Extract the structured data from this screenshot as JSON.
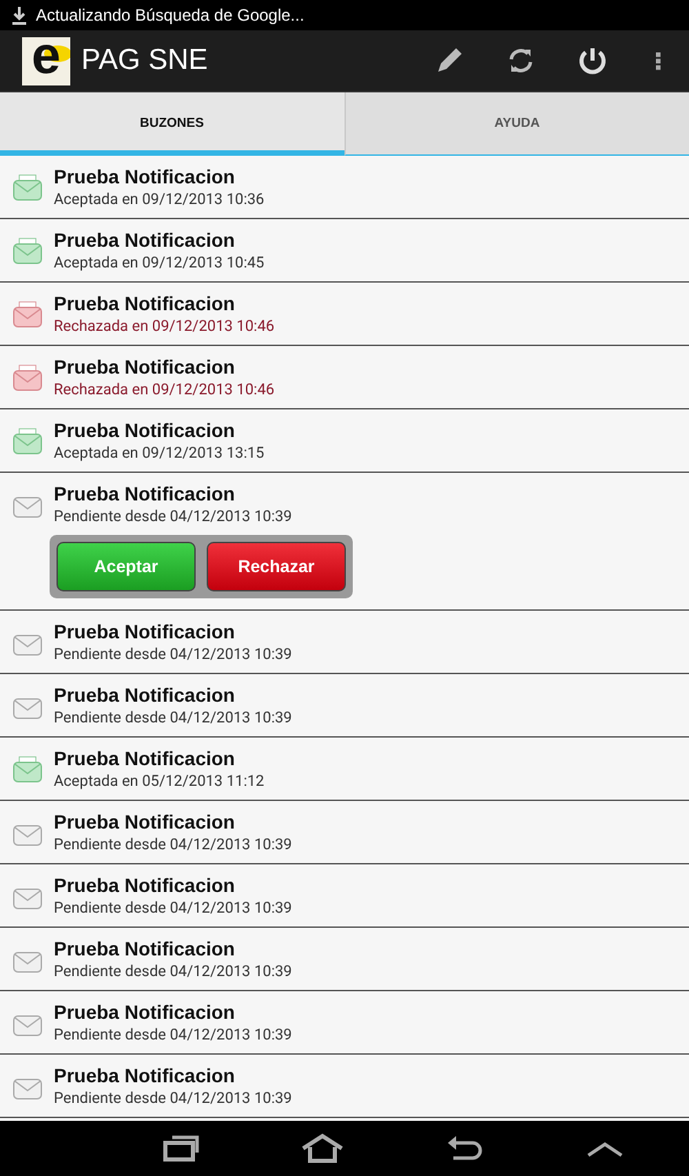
{
  "status_bar": {
    "notification": "Actualizando Búsqueda de Google..."
  },
  "action_bar": {
    "logo_letter": "e",
    "title": "PAG SNE"
  },
  "tabs": [
    {
      "label": "BUZONES",
      "selected": true
    },
    {
      "label": "AYUDA",
      "selected": false
    }
  ],
  "notifications": [
    {
      "title": "Prueba Notificacion",
      "kind": "accepted",
      "subtitle": "Aceptada en 09/12/2013 10:36"
    },
    {
      "title": "Prueba Notificacion",
      "kind": "accepted",
      "subtitle": "Aceptada en 09/12/2013 10:45"
    },
    {
      "title": "Prueba Notificacion",
      "kind": "rejected",
      "subtitle": "Rechazada en 09/12/2013 10:46"
    },
    {
      "title": "Prueba Notificacion",
      "kind": "rejected",
      "subtitle": "Rechazada en 09/12/2013 10:46"
    },
    {
      "title": "Prueba Notificacion",
      "kind": "accepted",
      "subtitle": "Aceptada en 09/12/2013 13:15"
    },
    {
      "title": "Prueba Notificacion",
      "kind": "pending",
      "subtitle": "Pendiente desde 04/12/2013 10:39",
      "actions": [
        "Aceptar",
        "Rechazar"
      ]
    },
    {
      "title": "Prueba Notificacion",
      "kind": "pending",
      "subtitle": "Pendiente desde 04/12/2013 10:39"
    },
    {
      "title": "Prueba Notificacion",
      "kind": "pending",
      "subtitle": "Pendiente desde 04/12/2013 10:39"
    },
    {
      "title": "Prueba Notificacion",
      "kind": "accepted",
      "subtitle": "Aceptada en 05/12/2013 11:12"
    },
    {
      "title": "Prueba Notificacion",
      "kind": "pending",
      "subtitle": "Pendiente desde 04/12/2013 10:39"
    },
    {
      "title": "Prueba Notificacion",
      "kind": "pending",
      "subtitle": "Pendiente desde 04/12/2013 10:39"
    },
    {
      "title": "Prueba Notificacion",
      "kind": "pending",
      "subtitle": "Pendiente desde 04/12/2013 10:39"
    },
    {
      "title": "Prueba Notificacion",
      "kind": "pending",
      "subtitle": "Pendiente desde 04/12/2013 10:39"
    },
    {
      "title": "Prueba Notificacion",
      "kind": "pending",
      "subtitle": "Pendiente desde 04/12/2013 10:39"
    }
  ]
}
